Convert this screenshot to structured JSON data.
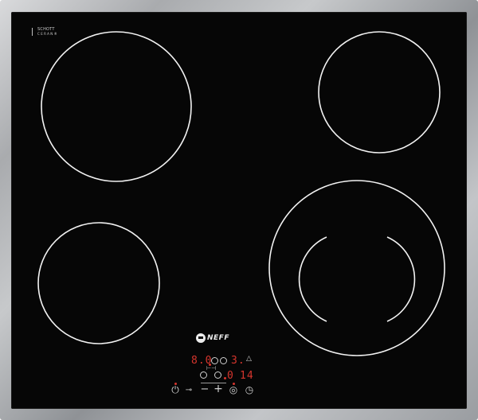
{
  "glass_brand": {
    "line1": "SCHOTT",
    "line2": "CERAN®"
  },
  "brand": {
    "name": "NEFF"
  },
  "display": {
    "left_value": "8.0",
    "left_secondary": "3.",
    "timer_prefix": "0",
    "timer_value": "14"
  },
  "controls": {
    "power_symbol": "⏻",
    "childlock_symbol": "⊸",
    "minus_symbol": "−",
    "plus_symbol": "+",
    "boost_symbol": "◎",
    "timer_symbol": "◷",
    "bell_symbol": "△",
    "link_symbol": "⊢⊣"
  },
  "colors": {
    "glass": "#060606",
    "ring": "#f2f2f2",
    "display_red": "#d6352d"
  }
}
